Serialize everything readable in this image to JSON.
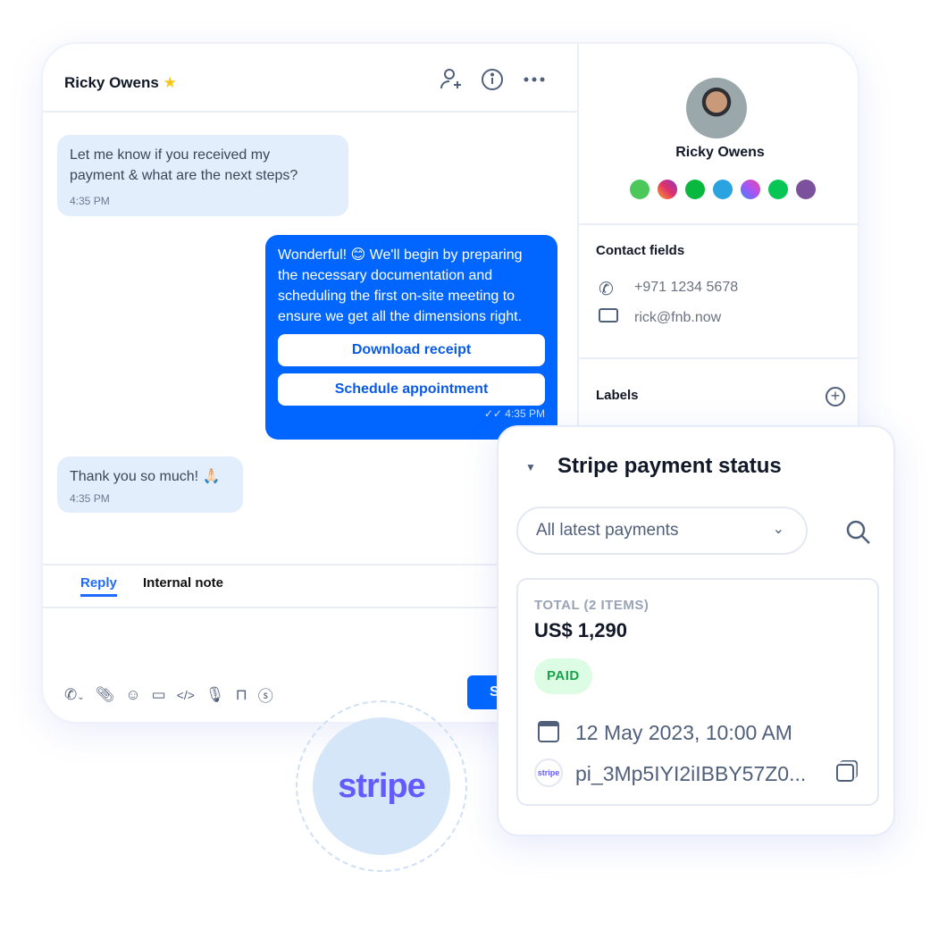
{
  "chat": {
    "contact_name": "Ricky Owens",
    "messages": [
      {
        "text_line1": "Let me know if you received my",
        "text_line2": "payment & what are the next steps?",
        "time": "4:35 PM"
      },
      {
        "text": "Wonderful! 😊 We'll begin by preparing the necessary documentation and scheduling the first on-site meeting to ensure we get all the dimensions right.",
        "buttons": [
          "Download receipt",
          "Schedule appointment"
        ],
        "time": "4:35 PM"
      },
      {
        "text": "Thank you so much! 🙏🏻",
        "time": "4:35 PM"
      }
    ],
    "tabs": [
      "Reply",
      "Internal note"
    ],
    "send_label": "S"
  },
  "contact": {
    "name": "Ricky Owens",
    "channels": [
      "whatsapp",
      "instagram",
      "wechat",
      "telegram",
      "messenger",
      "line",
      "viber"
    ],
    "fields_title": "Contact fields",
    "phone": "+971 1234 5678",
    "email": "rick@fnb.now",
    "labels_title": "Labels"
  },
  "stripe": {
    "title": "Stripe payment status",
    "filter": "All latest payments",
    "total_label": "TOTAL (2 ITEMS)",
    "amount": "US$ 1,290",
    "status": "PAID",
    "date": "12 May 2023, 10:00 AM",
    "payment_id": "pi_3Mp5IYI2iIBBY57Z0...",
    "logo": "stripe",
    "brand_color": "#635bff"
  }
}
